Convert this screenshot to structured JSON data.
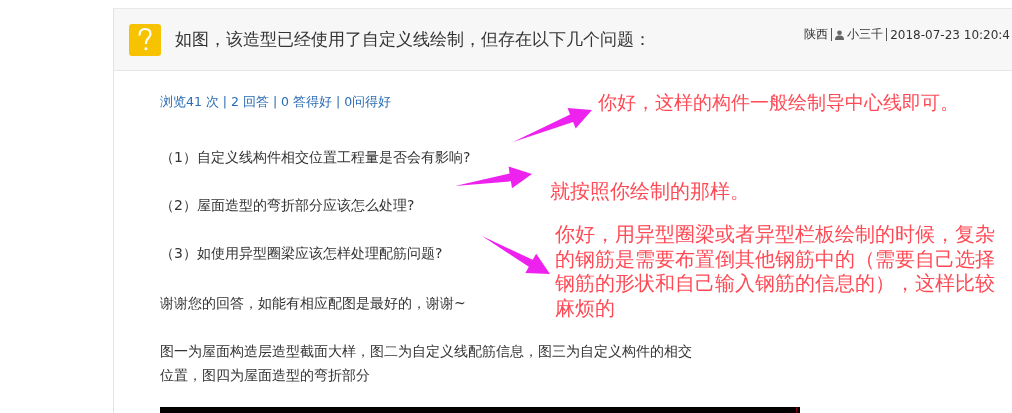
{
  "question": {
    "title": "如图，该造型已经使用了自定义线绘制，但存在以下几个问题：",
    "location": "陕西",
    "author": "小三千",
    "time": "2018-07-23 10:20:4"
  },
  "stats": "浏览41 次 | 2 回答 | 0 答得好 | 0问得好",
  "items": [
    "（1）自定义线构件相交位置工程量是否会有影响?",
    "（2）屋面造型的弯折部分应该怎么处理?",
    "（3）如使用异型圈梁应该怎样处理配筋问题?"
  ],
  "thanks": "谢谢您的回答，如能有相应配图是最好的，谢谢~",
  "description": "图一为屋面构造层造型截面大样，图二为自定义线配筋信息，图三为自定义构件的相交位置，图四为屋面造型的弯折部分",
  "annotations": [
    "你好，这样的构件一般绘制导中心线即可。",
    "就按照你绘制的那样。",
    "你好，用异型圈梁或者异型栏板绘制的时候，复杂的钢筋是需要布置倒其他钢筋中的（需要自己选择钢筋的形状和自己输入钢筋的信息的），这样比较麻烦的"
  ]
}
